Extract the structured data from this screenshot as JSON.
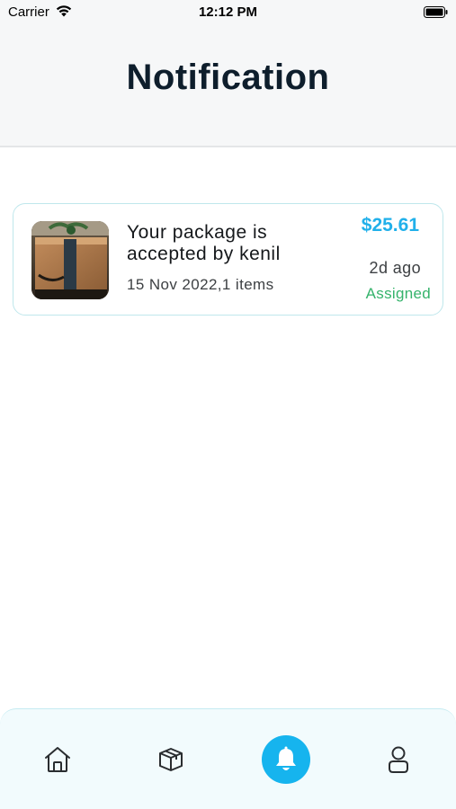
{
  "status_bar": {
    "carrier": "Carrier",
    "time": "12:12 PM",
    "icons": [
      "wifi-icon",
      "battery-icon"
    ]
  },
  "header": {
    "title": "Notification"
  },
  "notifications": [
    {
      "title": "Your package is accepted by kenil",
      "subtitle": "15 Nov 2022,1 items",
      "price": "$25.61",
      "time_ago": "2d ago",
      "status": "Assigned",
      "thumbnail": "package-photo"
    }
  ],
  "bottom_nav": {
    "items": [
      {
        "icon": "home-icon",
        "active": false
      },
      {
        "icon": "package-icon",
        "active": false
      },
      {
        "icon": "bell-icon",
        "active": true
      },
      {
        "icon": "user-icon",
        "active": false
      }
    ]
  },
  "colors": {
    "accent": "#16b4ee",
    "price": "#21b0ea",
    "status_assigned": "#35b36b",
    "title_dark": "#0e1e2c",
    "card_border": "#bfe7ec",
    "nav_background": "#f2fbfd"
  }
}
